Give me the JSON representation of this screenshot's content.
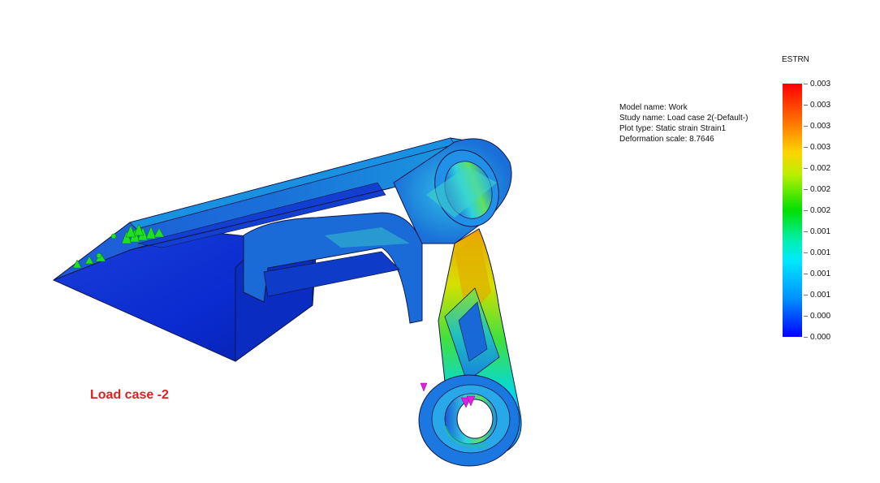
{
  "study_info": {
    "model_name": "Model name: Work",
    "study_name": "Study name: Load case 2(-Default-)",
    "plot_type": "Plot type: Static strain Strain1",
    "deformation_scale": "Deformation scale: 8.7646"
  },
  "legend": {
    "title": "ESTRN",
    "ticks": [
      "0.003",
      "0.003",
      "0.003",
      "0.003",
      "0.002",
      "0.002",
      "0.002",
      "0.001",
      "0.001",
      "0.001",
      "0.001",
      "0.000",
      "0.000"
    ],
    "colors": {
      "max": "#ff0000",
      "high": "#ffd400",
      "mid": "#00e000",
      "low": "#00e8ff",
      "min": "#0000ff"
    }
  },
  "caption": "Load case -2"
}
